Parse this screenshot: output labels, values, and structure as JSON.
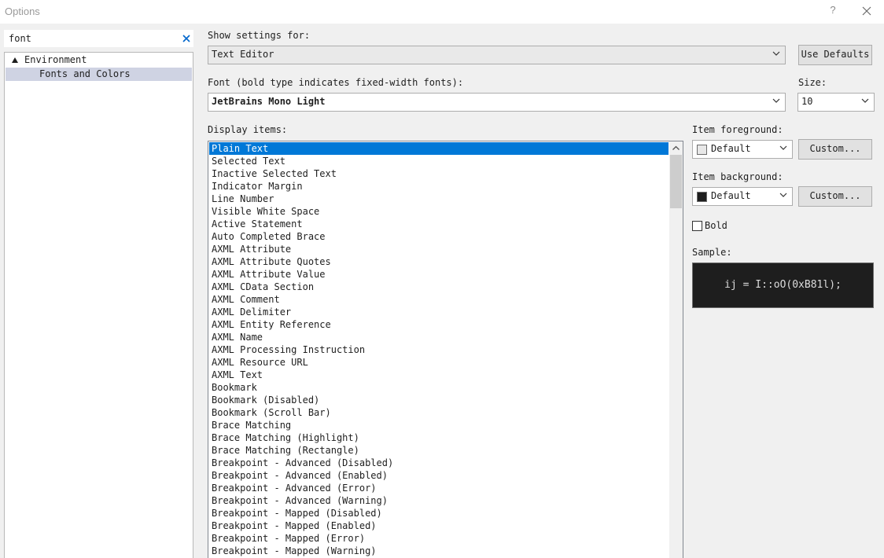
{
  "window": {
    "title": "Options",
    "help_label": "?"
  },
  "search": {
    "value": "font"
  },
  "tree": {
    "items": [
      {
        "label": "Environment"
      },
      {
        "label": "Fonts and Colors"
      }
    ]
  },
  "settings": {
    "show_settings_label": "Show settings for:",
    "show_settings_value": "Text Editor",
    "use_defaults_label": "Use Defaults",
    "font_label": "Font (bold type indicates fixed-width fonts):",
    "font_value": "JetBrains Mono Light",
    "size_label": "Size:",
    "size_value": "10",
    "display_items_label": "Display items:"
  },
  "display_items": [
    "Plain Text",
    "Selected Text",
    "Inactive Selected Text",
    "Indicator Margin",
    "Line Number",
    "Visible White Space",
    "Active Statement",
    "Auto Completed Brace",
    "AXML Attribute",
    "AXML Attribute Quotes",
    "AXML Attribute Value",
    "AXML CData Section",
    "AXML Comment",
    "AXML Delimiter",
    "AXML Entity Reference",
    "AXML Name",
    "AXML Processing Instruction",
    "AXML Resource URL",
    "AXML Text",
    "Bookmark",
    "Bookmark (Disabled)",
    "Bookmark (Scroll Bar)",
    "Brace Matching",
    "Brace Matching (Highlight)",
    "Brace Matching (Rectangle)",
    "Breakpoint - Advanced (Disabled)",
    "Breakpoint - Advanced (Enabled)",
    "Breakpoint - Advanced (Error)",
    "Breakpoint - Advanced (Warning)",
    "Breakpoint - Mapped (Disabled)",
    "Breakpoint - Mapped (Enabled)",
    "Breakpoint - Mapped (Error)",
    "Breakpoint - Mapped (Warning)"
  ],
  "selected_item": "Plain Text",
  "foreground": {
    "label": "Item foreground:",
    "value": "Default",
    "swatch_color": "#e8e8e8",
    "custom_label": "Custom..."
  },
  "background": {
    "label": "Item background:",
    "value": "Default",
    "swatch_color": "#1e1e1e",
    "custom_label": "Custom..."
  },
  "bold": {
    "label": "Bold",
    "checked": false
  },
  "sample": {
    "label": "Sample:",
    "text": "ij = I::oO(0xB81l);",
    "background": "#1e1e1e",
    "foreground": "#dcdcdc"
  },
  "colors": {
    "selection": "#0078d7",
    "tree_selection": "#cfd3e3",
    "search_clear": "#0066cc"
  }
}
